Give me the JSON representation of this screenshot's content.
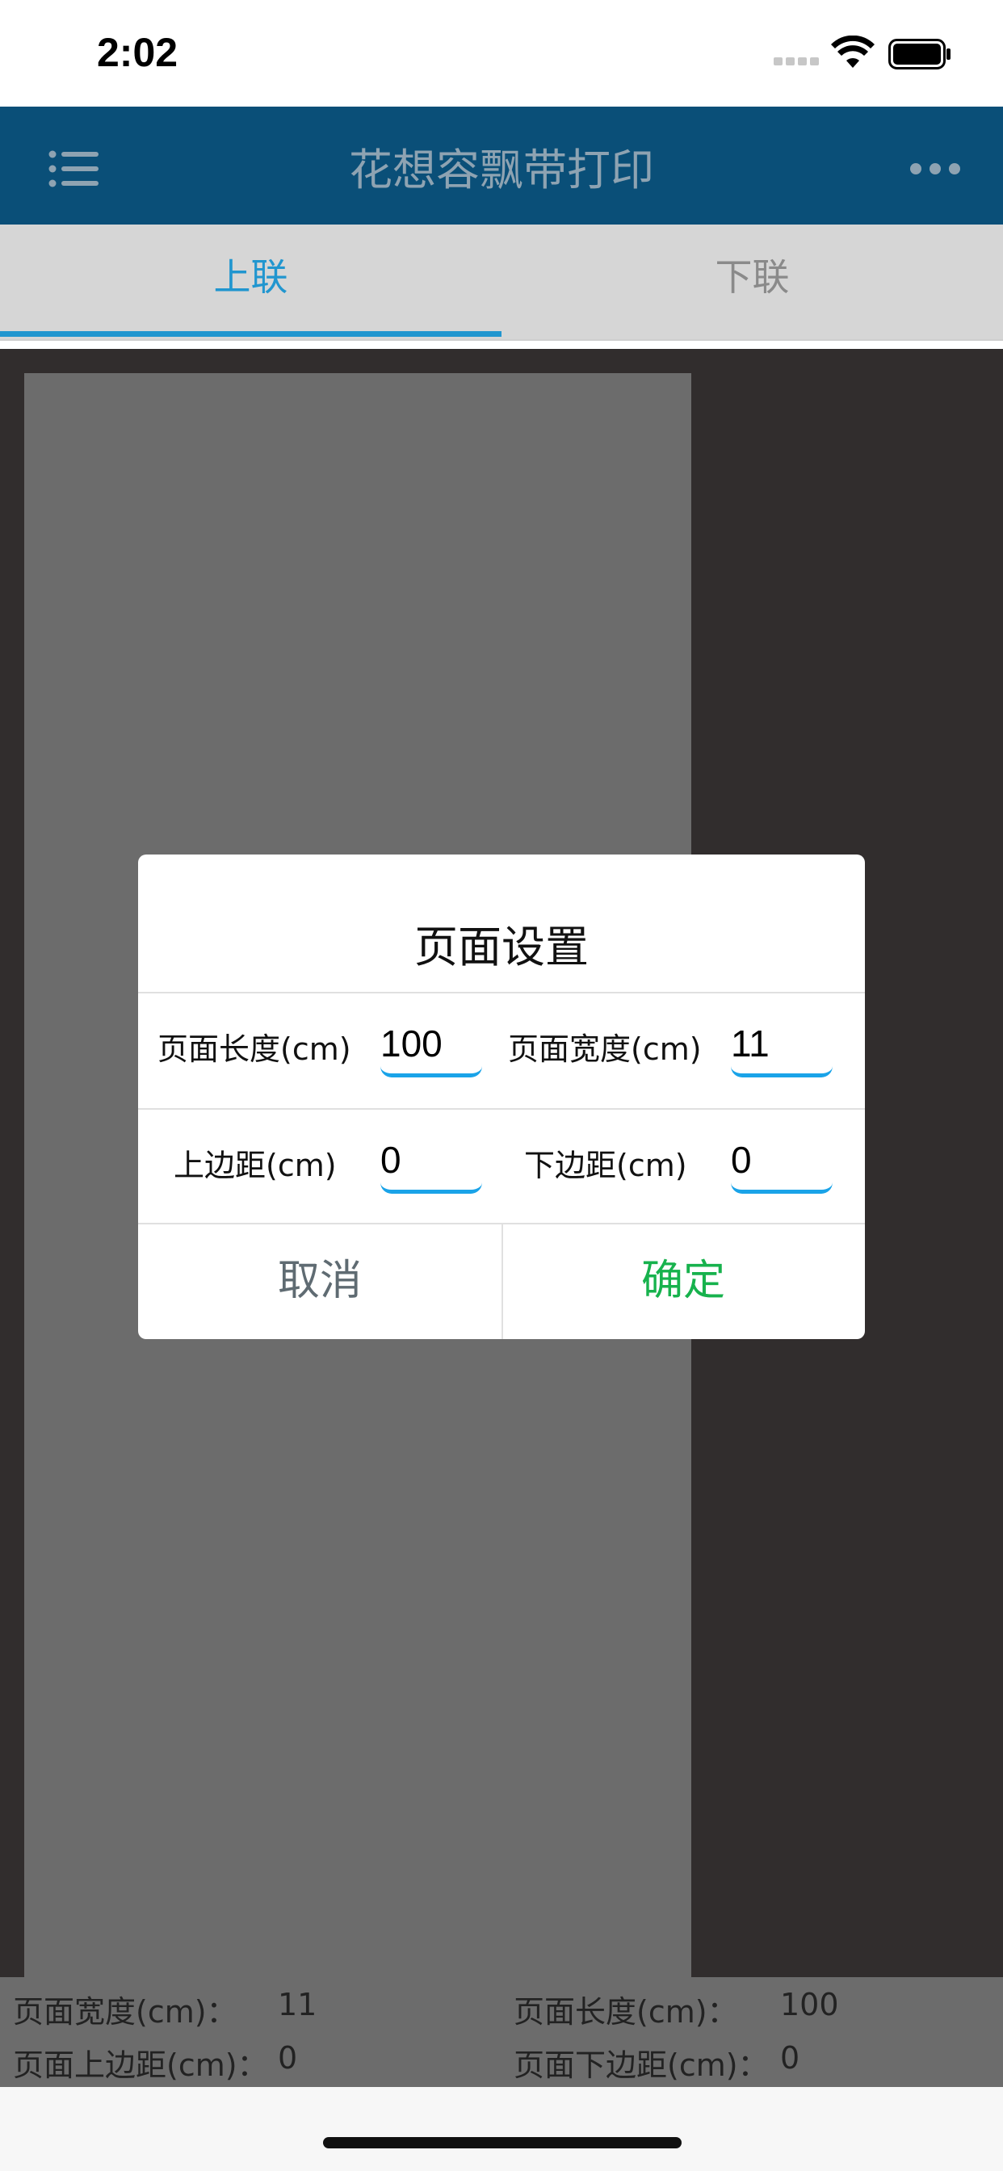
{
  "status_bar": {
    "time": "2:02"
  },
  "nav": {
    "title": "花想容飘带打印",
    "menu_icon": "list-icon",
    "more_icon": "more-horizontal-icon",
    "bg_color": "#0a4f78"
  },
  "tabs": [
    {
      "label": "上联",
      "active": true
    },
    {
      "label": "下联",
      "active": false
    }
  ],
  "dialog": {
    "title": "页面设置",
    "fields": {
      "page_length_label": "页面长度(cm)",
      "page_length_value": "100",
      "page_width_label": "页面宽度(cm)",
      "page_width_value": "11",
      "top_margin_label": "上边距(cm)",
      "top_margin_value": "0",
      "bottom_margin_label": "下边距(cm)",
      "bottom_margin_value": "0"
    },
    "cancel_label": "取消",
    "confirm_label": "确定",
    "confirm_color": "#17b24d",
    "input_accent_color": "#1aa3e8"
  },
  "info": {
    "page_width_label": "页面宽度(cm)：",
    "page_width_value": "11",
    "page_length_label": "页面长度(cm)：",
    "page_length_value": "100",
    "top_margin_label": "页面上边距(cm)：",
    "top_margin_value": "0",
    "bottom_margin_label": "页面下边距(cm)：",
    "bottom_margin_value": "0"
  }
}
